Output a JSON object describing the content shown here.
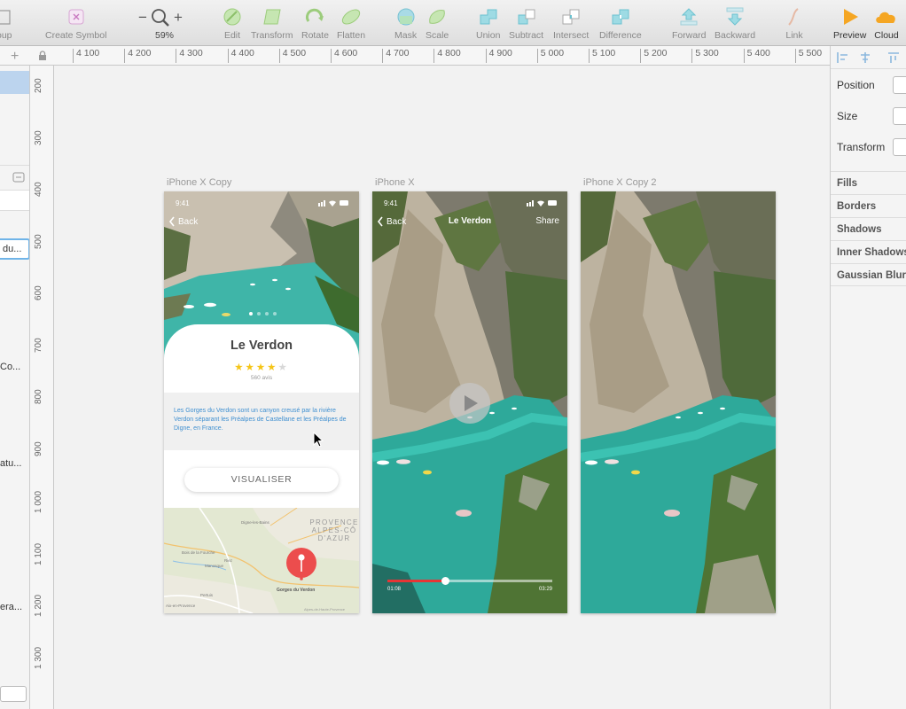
{
  "toolbar": {
    "group": "oup",
    "create_symbol": "Create Symbol",
    "zoom_minus": "−",
    "zoom_plus": "+",
    "zoom_level": "59%",
    "edit": "Edit",
    "transform": "Transform",
    "rotate": "Rotate",
    "flatten": "Flatten",
    "mask": "Mask",
    "scale": "Scale",
    "union": "Union",
    "subtract": "Subtract",
    "intersect": "Intersect",
    "difference": "Difference",
    "forward": "Forward",
    "backward": "Backward",
    "link": "Link",
    "preview": "Preview",
    "cloud": "Cloud"
  },
  "ruler": {
    "top": [
      "4 100",
      "4 200",
      "4 300",
      "4 400",
      "4 500",
      "4 600",
      "4 700",
      "4 800",
      "4 900",
      "5 000",
      "5 100",
      "5 200",
      "5 300",
      "5 400",
      "5 500"
    ],
    "left": [
      "200",
      "300",
      "400",
      "500",
      "600",
      "700",
      "800",
      "900",
      "1 000",
      "1 100",
      "1 200",
      "1 300"
    ]
  },
  "layers": {
    "items": [
      "du...",
      "Co...",
      "atu...",
      "era..."
    ]
  },
  "inspector": {
    "position": "Position",
    "size": "Size",
    "transform": "Transform",
    "fills": "Fills",
    "borders": "Borders",
    "shadows": "Shadows",
    "inner_shadows": "Inner Shadows",
    "gaussian_blur": "Gaussian Blur"
  },
  "artboards": {
    "copy": {
      "label": "iPhone X Copy",
      "time": "9:41",
      "back": "Back",
      "title": "Le Verdon",
      "rating": 4,
      "stars": "★★★★",
      "star_empty": "★",
      "reviews": "560 avis",
      "description": "Les Gorges du Verdon sont un canyon creusé par la rivière Verdon séparant les Préalpes de Castellane et les Préalpes de Digne, en France.",
      "button": "VISUALISER",
      "map_labels": {
        "region1": "PROVENCE",
        "region2": "ALPES-CÔ",
        "region3": "D'AZUR",
        "digne": "Digne-les-Bains",
        "bois": "Bois de la Fourche",
        "riez": "Riez",
        "manosque": "Manosque",
        "pertuis": "Pertuis",
        "aix": "Aix-en-Provence",
        "gorges": "Gorges du Verdon",
        "alpes": "Alpes-de-Haute-Provence"
      }
    },
    "video": {
      "label": "iPhone X",
      "time": "9:41",
      "back": "Back",
      "title": "Le Verdon",
      "share": "Share",
      "time_current": "01:08",
      "time_total": "03:29",
      "progress": 0.35
    },
    "copy2": {
      "label": "iPhone X Copy 2"
    }
  }
}
